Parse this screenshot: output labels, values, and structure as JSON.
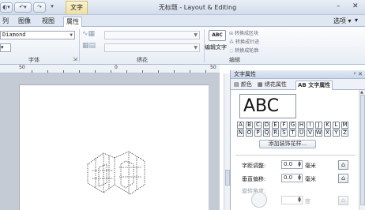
{
  "window": {
    "context_tab": "文字",
    "title": "无标题 - Layout & Editing",
    "minimize": "–",
    "close": "✕"
  },
  "ribbon_tabs": {
    "items": [
      "列",
      "图像",
      "视图",
      "属性"
    ],
    "active_index": 3,
    "options": "选项 ▾",
    "help": "▾"
  },
  "ribbon": {
    "font_name": "Diamond",
    "font_group": "字体",
    "embroidery_group": "绣花",
    "edit_group": "编辑",
    "abc_button": "ABC",
    "edit_text": "编辑文字",
    "cmd_convert_block": "转换成区块",
    "cmd_convert_stitch": "转换成针迹",
    "cmd_convert_outline": "转换成轮廓"
  },
  "ruler": {
    "labels": [
      "50",
      "0",
      "50"
    ]
  },
  "text_panel": {
    "title": "文字属性",
    "pin": "ᵖ",
    "close": "✕",
    "tabs": [
      "颜色",
      "绣花属性",
      "文字属性"
    ],
    "active_tab": 2,
    "preview_text": "ABC",
    "letters_row1": [
      "A",
      "B",
      "C",
      "D",
      "E",
      "F",
      "G",
      "H",
      "I",
      "J",
      "K",
      "L",
      "M"
    ],
    "letters_row2": [
      "N",
      "O",
      "P",
      "Q",
      "R",
      "S",
      "T",
      "U",
      "V",
      "W",
      "X",
      "Y",
      "Z"
    ],
    "add_button": "添加装饰花样...",
    "char_spacing_label": "字距调整:",
    "char_spacing_value": "0.0",
    "vertical_offset_label": "垂直偏移:",
    "vertical_offset_value": "0.0",
    "unit": "毫米",
    "rotation_label": "旋转角度:",
    "rotation_unit": "度"
  },
  "colors": {
    "accent": "#d7bf6b",
    "panel_bg": "#eef2f8",
    "canvas_bg": "#c5cbd4"
  }
}
